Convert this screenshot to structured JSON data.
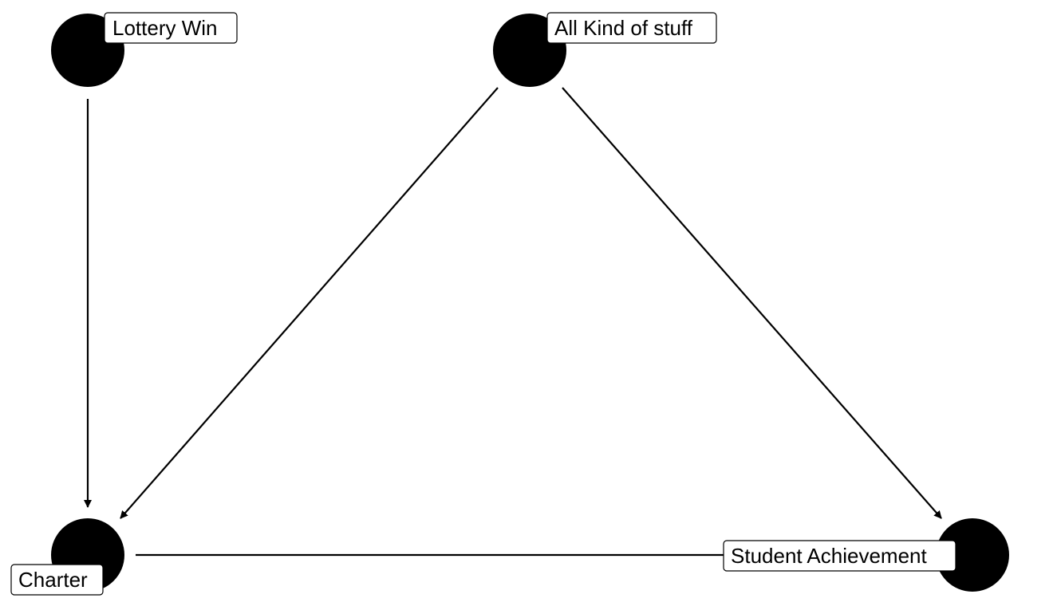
{
  "nodes": [
    {
      "id": "lottery",
      "label": "Lottery Win"
    },
    {
      "id": "stuff",
      "label": "All Kind of stuff"
    },
    {
      "id": "charter",
      "label": "Charter"
    },
    {
      "id": "achievement",
      "label": "Student Achievement"
    }
  ],
  "edges": [
    {
      "from": "Lottery Win",
      "to": "Charter",
      "directed": true
    },
    {
      "from": "All Kind of stuff",
      "to": "Charter",
      "directed": true
    },
    {
      "from": "All Kind of stuff",
      "to": "Student Achievement",
      "directed": true
    },
    {
      "from": "Charter",
      "to": "Student Achievement",
      "directed": false
    }
  ],
  "colors": {
    "node": "#000000",
    "edge": "#000000",
    "label_background": "#ffffff",
    "label_border": "#000000"
  }
}
